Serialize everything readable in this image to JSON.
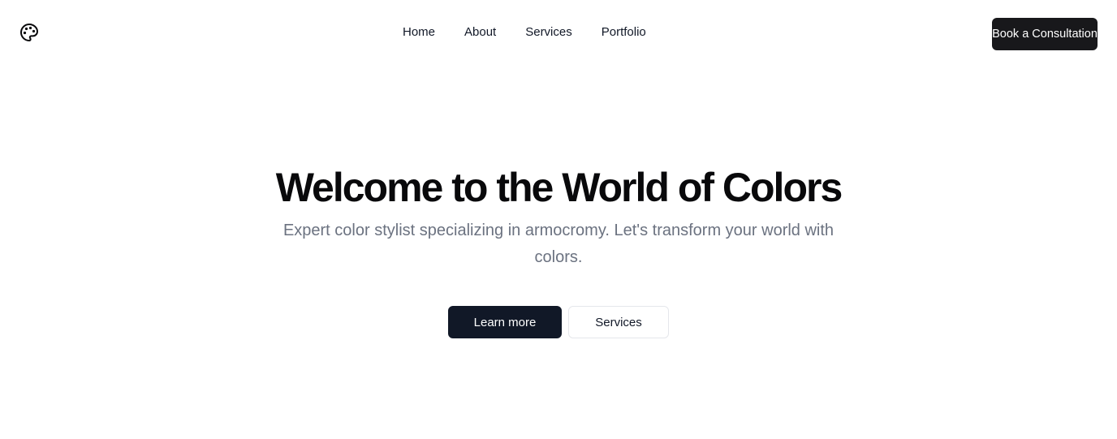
{
  "header": {
    "logo_icon": "palette-icon",
    "nav": [
      {
        "label": "Home"
      },
      {
        "label": "About"
      },
      {
        "label": "Services"
      },
      {
        "label": "Portfolio"
      }
    ],
    "cta_label": "Book a Consultation"
  },
  "hero": {
    "title": "Welcome to the World of Colors",
    "subtitle": "Expert color stylist specializing in armocromy. Let's transform your world with colors.",
    "primary_label": "Learn more",
    "secondary_label": "Services"
  },
  "colors": {
    "primary": "#111827",
    "cta": "#18181b",
    "muted_text": "#6b7280",
    "border": "#e5e7eb",
    "background": "#ffffff"
  }
}
